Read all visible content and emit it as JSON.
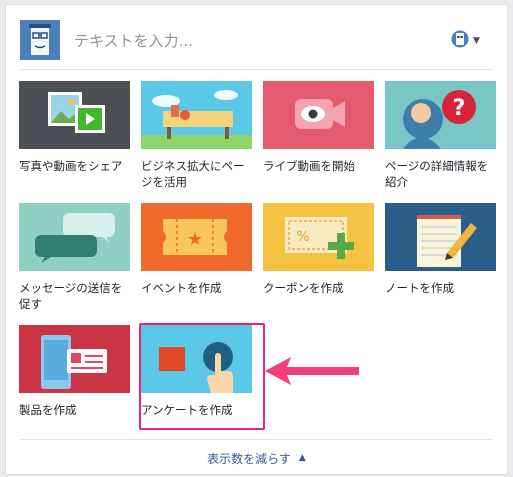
{
  "composer": {
    "placeholder": "テキストを入力..."
  },
  "tiles": [
    {
      "label": "写真や動画をシェア",
      "icon": "photo-video-icon"
    },
    {
      "label": "ビジネス拡大にページを活用",
      "icon": "store-icon"
    },
    {
      "label": "ライブ動画を開始",
      "icon": "live-video-icon"
    },
    {
      "label": "ページの詳細情報を紹介",
      "icon": "question-person-icon"
    },
    {
      "label": "メッセージの送信を促す",
      "icon": "messages-icon"
    },
    {
      "label": "イベントを作成",
      "icon": "event-ticket-icon"
    },
    {
      "label": "クーポンを作成",
      "icon": "coupon-icon"
    },
    {
      "label": "ノートを作成",
      "icon": "note-icon"
    },
    {
      "label": "製品を作成",
      "icon": "product-icon"
    },
    {
      "label": "アンケートを作成",
      "icon": "poll-icon"
    }
  ],
  "footer": {
    "show_less": "表示数を減らす"
  },
  "colors": {
    "highlight": "#e8257c",
    "link": "#365899"
  }
}
